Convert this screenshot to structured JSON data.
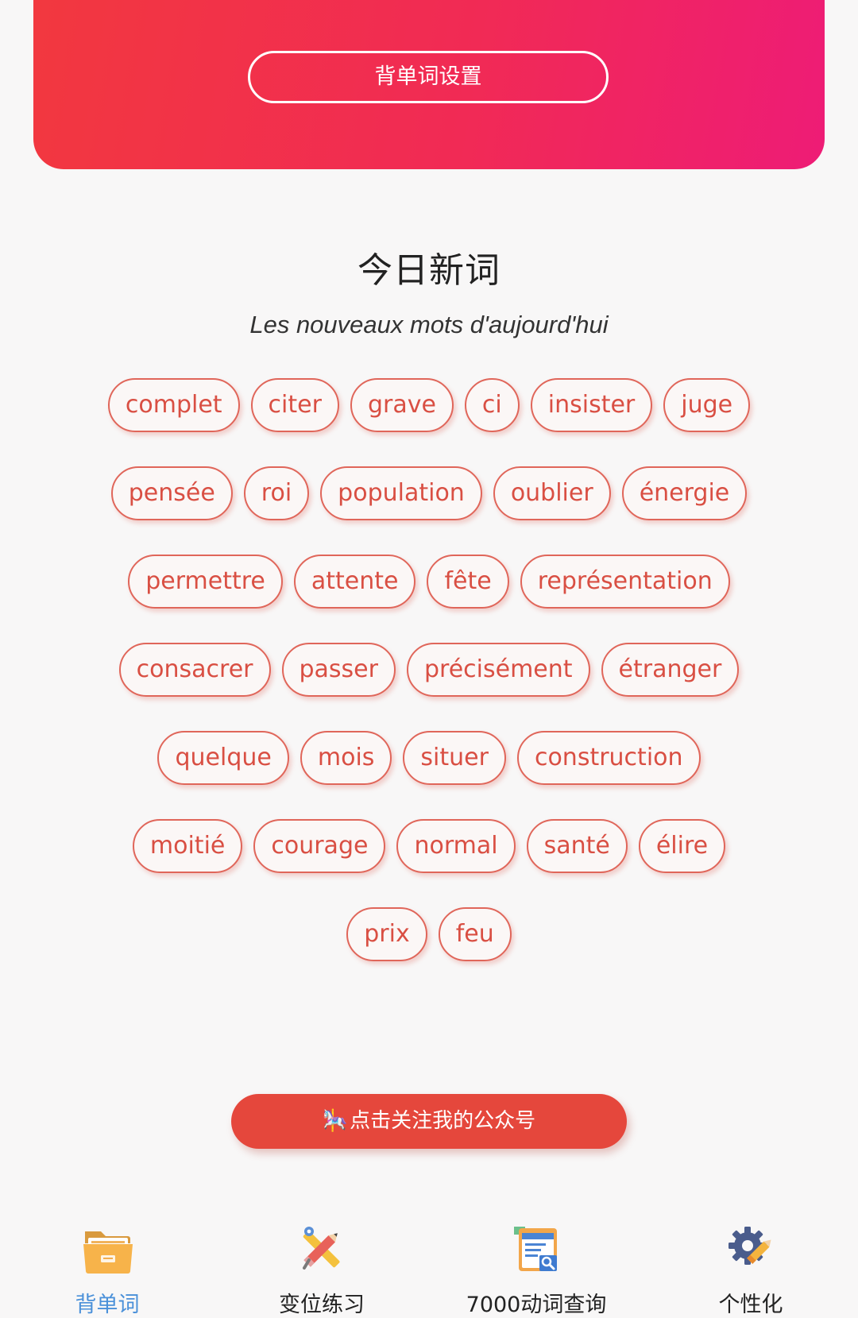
{
  "header": {
    "settings_label": "背单词设置"
  },
  "section": {
    "title": "今日新词",
    "subtitle": "Les nouveaux mots d'aujourd'hui"
  },
  "word_rows": [
    [
      "complet",
      "citer",
      "grave",
      "ci",
      "insister",
      "juge"
    ],
    [
      "pensée",
      "roi",
      "population",
      "oublier",
      "énergie"
    ],
    [
      "permettre",
      "attente",
      "fête",
      "représentation"
    ],
    [
      "consacrer",
      "passer",
      "précisément",
      "étranger"
    ],
    [
      "quelque",
      "mois",
      "situer",
      "construction"
    ],
    [
      "moitié",
      "courage",
      "normal",
      "santé",
      "élire"
    ],
    [
      "prix",
      "feu"
    ]
  ],
  "follow_button": {
    "label": "点击关注我的公众号",
    "icon": "carousel-horse-icon"
  },
  "tabs": [
    {
      "label": "背单词",
      "icon": "folder-icon",
      "active": true
    },
    {
      "label": "变位练习",
      "icon": "pencil-ruler-icon",
      "active": false
    },
    {
      "label": "7000动词查询",
      "icon": "document-search-icon",
      "active": false
    },
    {
      "label": "个性化",
      "icon": "gear-pencil-icon",
      "active": false
    }
  ],
  "colors": {
    "accent_red": "#e5473c",
    "chip_text": "#d94f43",
    "active_tab": "#4a90d9"
  }
}
